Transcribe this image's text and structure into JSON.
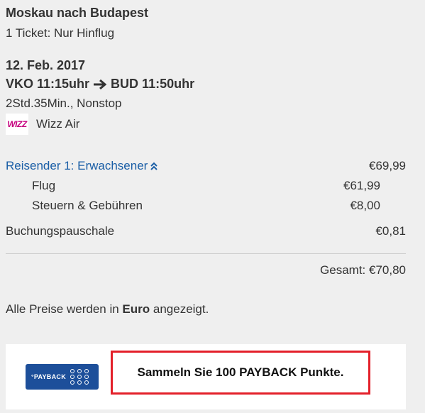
{
  "trip": {
    "route_title": "Moskau nach Budapest",
    "ticket_type": "1 Ticket: Nur Hinflug"
  },
  "flight": {
    "date": "12. Feb. 2017",
    "departure": "VKO 11:15uhr",
    "arrival": "BUD 11:50uhr",
    "duration_stops": "2Std.35Min., Nonstop",
    "airline_logo_text": "WIZZ",
    "airline_name": "Wizz Air"
  },
  "pricing": {
    "traveler_label": "Reisender 1: Erwachsener",
    "traveler_price": "€69,99",
    "flight_label": "Flug",
    "flight_price": "€61,99",
    "taxes_label": "Steuern & Gebühren",
    "taxes_price": "€8,00",
    "booking_fee_label": "Buchungspauschale",
    "booking_fee_price": "€0,81",
    "total": "Gesamt: €70,80"
  },
  "currency_note": {
    "before": "Alle Preise werden in ",
    "currency": "Euro",
    "after": " angezeigt."
  },
  "payback": {
    "logo_text": "°PAYBACK",
    "cta": "Sammeln Sie 100 PAYBACK Punkte."
  },
  "colors": {
    "link": "#1a5ea6",
    "highlight_border": "#e3202a",
    "payback_blue": "#1d4f9a",
    "wizz_magenta": "#c6007e"
  }
}
